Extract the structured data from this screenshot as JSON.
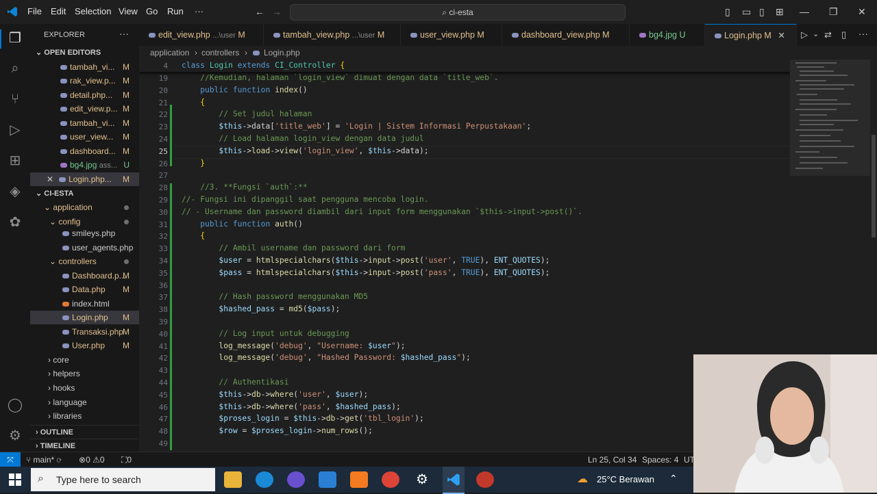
{
  "menu": [
    "File",
    "Edit",
    "Selection",
    "View",
    "Go",
    "Run",
    "···"
  ],
  "command_center": "ci-esta",
  "explorer": {
    "title": "EXPLORER",
    "open_editors_title": "OPEN EDITORS",
    "open_editors": [
      {
        "label": "tambah_vi...",
        "status": "M"
      },
      {
        "label": "rak_view.p...",
        "status": "M"
      },
      {
        "label": "detail.php...",
        "status": "M"
      },
      {
        "label": "edit_view.p...",
        "status": "M"
      },
      {
        "label": "tambah_vi...",
        "status": "M"
      },
      {
        "label": "user_view...",
        "status": "M"
      },
      {
        "label": "dashboard...",
        "status": "M"
      },
      {
        "label": "bg4.jpg",
        "sub": "ass...",
        "status": "U"
      },
      {
        "label": "Login.php...",
        "status": "M"
      }
    ],
    "project_title": "CI-ESTA",
    "tree": [
      {
        "label": "application",
        "indent": 1
      },
      {
        "label": "config",
        "indent": 2
      },
      {
        "label": "smileys.php",
        "indent": 3
      },
      {
        "label": "user_agents.php",
        "indent": 3
      },
      {
        "label": "controllers",
        "indent": 2
      },
      {
        "label": "Dashboard.p...",
        "status": "M",
        "indent": 3
      },
      {
        "label": "Data.php",
        "status": "M",
        "indent": 3
      },
      {
        "label": "index.html",
        "indent": 3
      },
      {
        "label": "Login.php",
        "status": "M",
        "indent": 3
      },
      {
        "label": "Transaksi.php",
        "status": "M",
        "indent": 3
      },
      {
        "label": "User.php",
        "status": "M",
        "indent": 3
      },
      {
        "label": "core",
        "indent": 2
      },
      {
        "label": "helpers",
        "indent": 2
      },
      {
        "label": "hooks",
        "indent": 2
      },
      {
        "label": "language",
        "indent": 2
      },
      {
        "label": "libraries",
        "indent": 2
      }
    ],
    "outline_title": "OUTLINE",
    "timeline_title": "TIMELINE"
  },
  "tabs": [
    {
      "label": "edit_view.php",
      "sub": "...\\user",
      "status": "M"
    },
    {
      "label": "tambah_view.php",
      "sub": "...\\user",
      "status": "M"
    },
    {
      "label": "user_view.php",
      "status": "M"
    },
    {
      "label": "dashboard_view.php",
      "status": "M"
    },
    {
      "label": "bg4.jpg",
      "status": "U"
    },
    {
      "label": "Login.php",
      "status": "M"
    }
  ],
  "breadcrumb": [
    "application",
    "controllers",
    "Login.php"
  ],
  "sticky": {
    "num": "4",
    "text": "class Login extends CI_Controller {"
  },
  "code_lines": [
    {
      "n": "19",
      "t": "    //Kemudian, halaman `login_view` dimuat dengan data `title_web`."
    },
    {
      "n": "20",
      "t": "    public function index()"
    },
    {
      "n": "21",
      "t": "    {"
    },
    {
      "n": "22",
      "t": "        // Set judul halaman"
    },
    {
      "n": "23",
      "t": "        $this->data['title_web'] = 'Login | Sistem Informasi Perpustakaan';"
    },
    {
      "n": "24",
      "t": "        // Load halaman login_view dengan data judul"
    },
    {
      "n": "25",
      "t": "        $this->load->view('login_view', $this->data);"
    },
    {
      "n": "26",
      "t": "    }"
    },
    {
      "n": "27",
      "t": ""
    },
    {
      "n": "28",
      "t": "    //3. **Fungsi `auth`:**"
    },
    {
      "n": "29",
      "t": "//- Fungsi ini dipanggil saat pengguna mencoba login."
    },
    {
      "n": "30",
      "t": "// - Username dan password diambil dari input form menggunakan `$this->input->post()`."
    },
    {
      "n": "31",
      "t": "    public function auth()"
    },
    {
      "n": "32",
      "t": "    {"
    },
    {
      "n": "33",
      "t": "        // Ambil username dan password dari form"
    },
    {
      "n": "34",
      "t": "        $user = htmlspecialchars($this->input->post('user', TRUE), ENT_QUOTES);"
    },
    {
      "n": "35",
      "t": "        $pass = htmlspecialchars($this->input->post('pass', TRUE), ENT_QUOTES);"
    },
    {
      "n": "36",
      "t": ""
    },
    {
      "n": "37",
      "t": "        // Hash password menggunakan MD5"
    },
    {
      "n": "38",
      "t": "        $hashed_pass = md5($pass);"
    },
    {
      "n": "39",
      "t": ""
    },
    {
      "n": "40",
      "t": "        // Log input untuk debugging"
    },
    {
      "n": "41",
      "t": "        log_message('debug', \"Username: $user\");"
    },
    {
      "n": "42",
      "t": "        log_message('debug', \"Hashed Password: $hashed_pass\");"
    },
    {
      "n": "43",
      "t": ""
    },
    {
      "n": "44",
      "t": "        // Authentikasi"
    },
    {
      "n": "45",
      "t": "        $this->db->where('user', $user);"
    },
    {
      "n": "46",
      "t": "        $this->db->where('pass', $hashed_pass);"
    },
    {
      "n": "47",
      "t": "        $proses_login = $this->db->get('tbl_login');"
    },
    {
      "n": "48",
      "t": "        $row = $proses_login->num_rows();"
    },
    {
      "n": "49",
      "t": ""
    }
  ],
  "current_line": "25",
  "status": {
    "branch": "main*",
    "errors": "0",
    "warnings": "0",
    "ports": "0",
    "position": "Ln 25, Col 34",
    "spaces": "Spaces: 4",
    "encoding": "UT"
  },
  "taskbar": {
    "search_placeholder": "Type here to search",
    "weather": "25°C  Berawan"
  },
  "colors": {
    "accent": "#0078d4",
    "modified": "#e2c08d",
    "untracked": "#73c991"
  }
}
